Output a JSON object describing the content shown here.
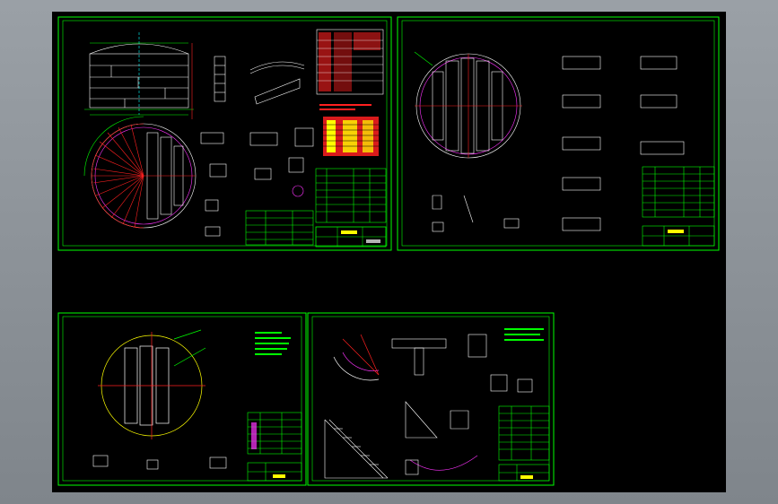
{
  "viewer": {
    "background_color": "#000000",
    "frame_color": "#8b9197",
    "colors": {
      "border": "#00ff00",
      "cyan": "#00ffff",
      "red": "#ff2020",
      "magenta": "#ff33ff",
      "yellow": "#ffff00",
      "white": "#ffffff",
      "green": "#00cc00"
    }
  },
  "sheets": [
    {
      "id": "sheet-1",
      "description_icon": "tank-assembly-drawing"
    },
    {
      "id": "sheet-2",
      "description_icon": "floating-roof-deck-plan"
    },
    {
      "id": "sheet-3",
      "description_icon": "bottom-plate-layout"
    },
    {
      "id": "sheet-4",
      "description_icon": "spiral-stair-details"
    }
  ]
}
